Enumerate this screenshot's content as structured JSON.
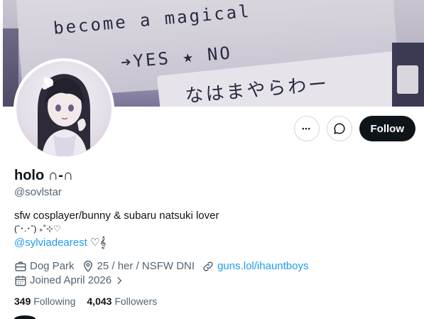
{
  "banner": {
    "line1": "become a magical",
    "line2": "➔YES  ★   NO",
    "line3": "なはまやらわー"
  },
  "actions": {
    "more_label": "•••",
    "follow_label": "Follow"
  },
  "profile": {
    "name": "holo ∩-∩",
    "handle": "@sovlstar",
    "bio_line1": "sfw cosplayer/bunny & subaru natsuki lover",
    "bio_line2": "(ˆ･.･ˆ) ₊˚⊹♡",
    "bio_mention": "@sylviadearest",
    "bio_mention_suffix": " ♡𝄞"
  },
  "meta": {
    "location": "Dog Park",
    "about": "25 / her / NSFW DNI",
    "link": "guns.lol/ihauntboys",
    "joined": "Joined April 2026"
  },
  "stats": {
    "following_count": "349",
    "following_label": "Following",
    "followers_count": "4,043",
    "followers_label": "Followers"
  },
  "colors": {
    "accent": "#1d9bf0",
    "text": "#0f1419",
    "muted": "#536471",
    "border": "#cfd9de"
  }
}
